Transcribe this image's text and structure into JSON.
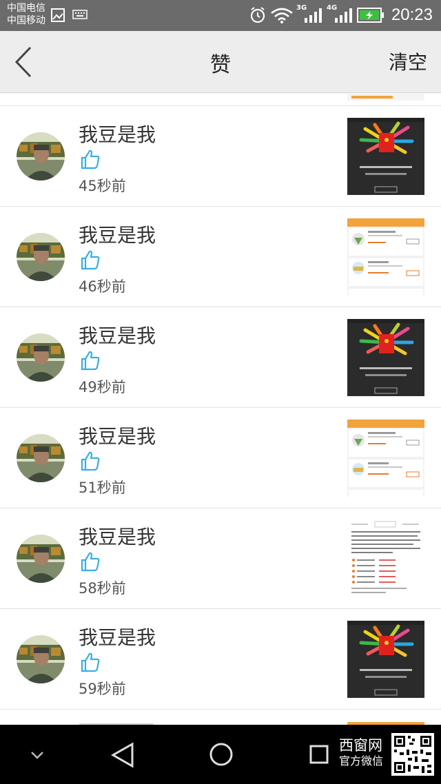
{
  "status_bar": {
    "carrier_1": "中国电信",
    "carrier_2": "中国移动",
    "net_3g": "3G",
    "net_4g": "4G",
    "time": "20:23"
  },
  "header": {
    "title": "赞",
    "clear_label": "清空"
  },
  "likes": [
    {
      "name": "我豆是我",
      "time": "45秒前",
      "thumb": "red-packet"
    },
    {
      "name": "我豆是我",
      "time": "46秒前",
      "thumb": "ranking-list"
    },
    {
      "name": "我豆是我",
      "time": "49秒前",
      "thumb": "red-packet"
    },
    {
      "name": "我豆是我",
      "time": "51秒前",
      "thumb": "ranking-list"
    },
    {
      "name": "我豆是我",
      "time": "58秒前",
      "thumb": "text-article"
    },
    {
      "name": "我豆是我",
      "time": "59秒前",
      "thumb": "red-packet"
    }
  ],
  "watermark": {
    "line1": "西窗网",
    "line2": "官方微信"
  },
  "icons": [
    "back-arrow-icon",
    "thumbs-up-icon",
    "alarm-icon",
    "wifi-icon",
    "battery-icon",
    "back-triangle-icon",
    "home-circle-icon",
    "recents-square-icon",
    "chevron-down-icon"
  ],
  "colors": {
    "like_blue": "#37aee3",
    "statusbar": "#6b6b6b",
    "header": "#ededed"
  }
}
